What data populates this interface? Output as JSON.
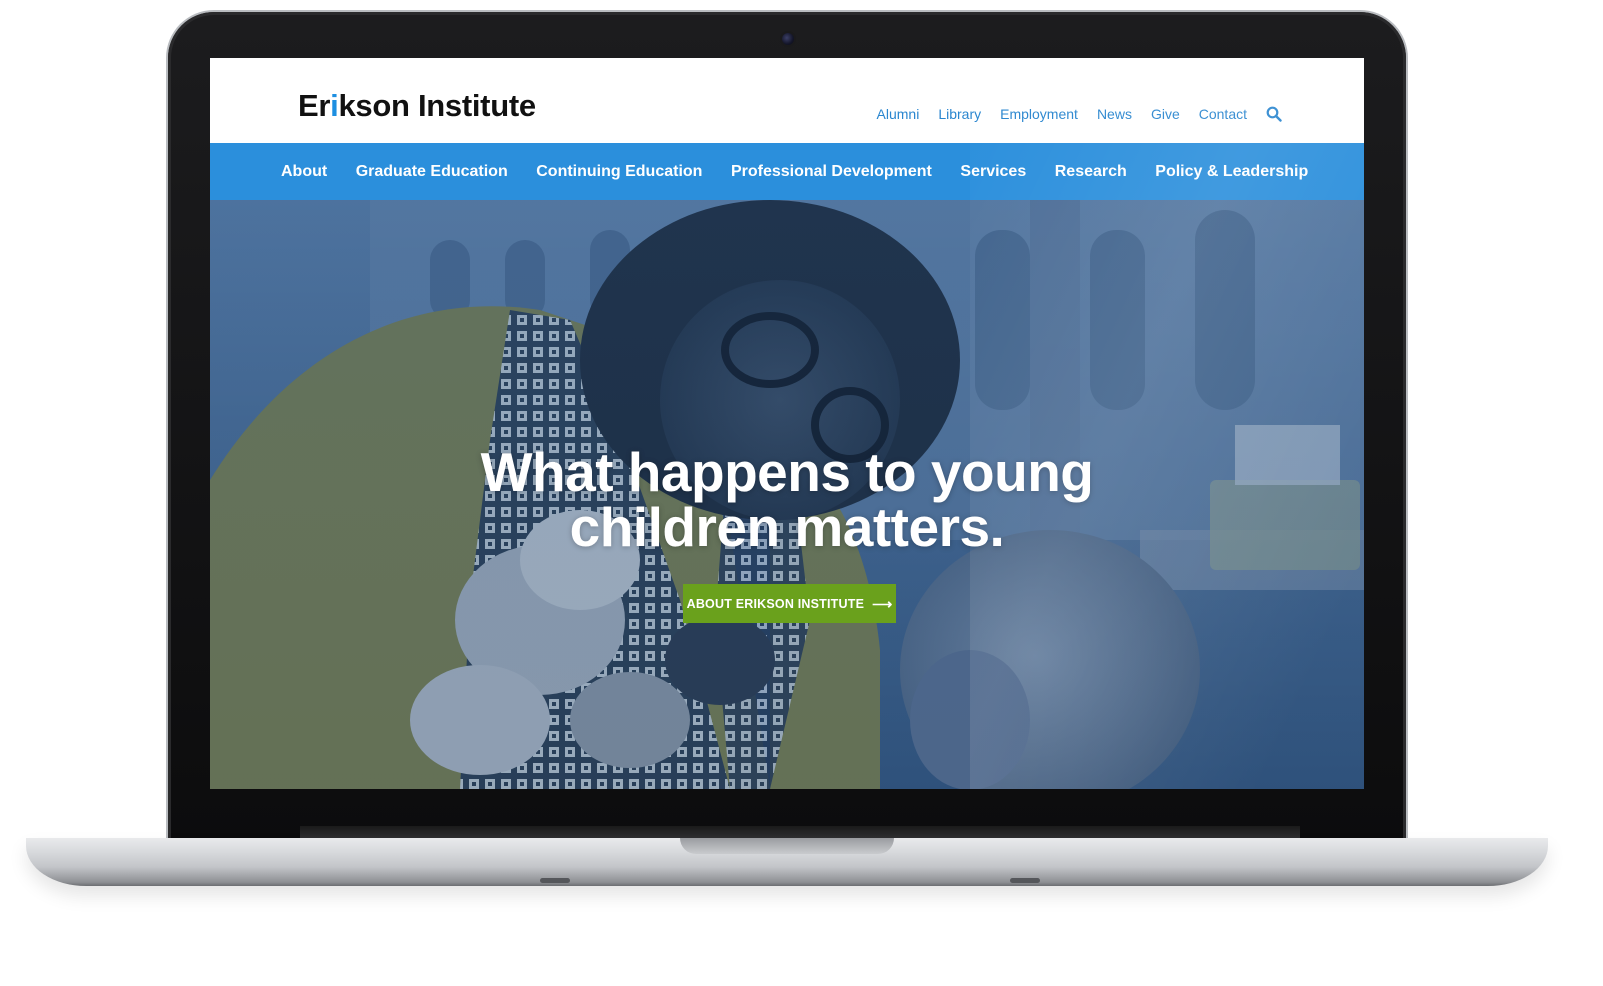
{
  "site": {
    "logo_text_before": "Er",
    "logo_accent": "i",
    "logo_text_after": "kson Institute",
    "brand_blue": "#2b8fdc",
    "accent_green": "#6aa11c"
  },
  "utility_nav": {
    "items": [
      "Alumni",
      "Library",
      "Employment",
      "News",
      "Give",
      "Contact"
    ],
    "search_icon": "search-icon"
  },
  "main_nav": {
    "items": [
      "About",
      "Graduate Education",
      "Continuing Education",
      "Professional Development",
      "Services",
      "Research",
      "Policy & Leadership"
    ]
  },
  "hero": {
    "title_line1": "What happens to young",
    "title_line2": "children matters.",
    "cta_label": "ABOUT ERIKSON INSTITUTE",
    "cta_icon": "arrow-right-icon"
  }
}
